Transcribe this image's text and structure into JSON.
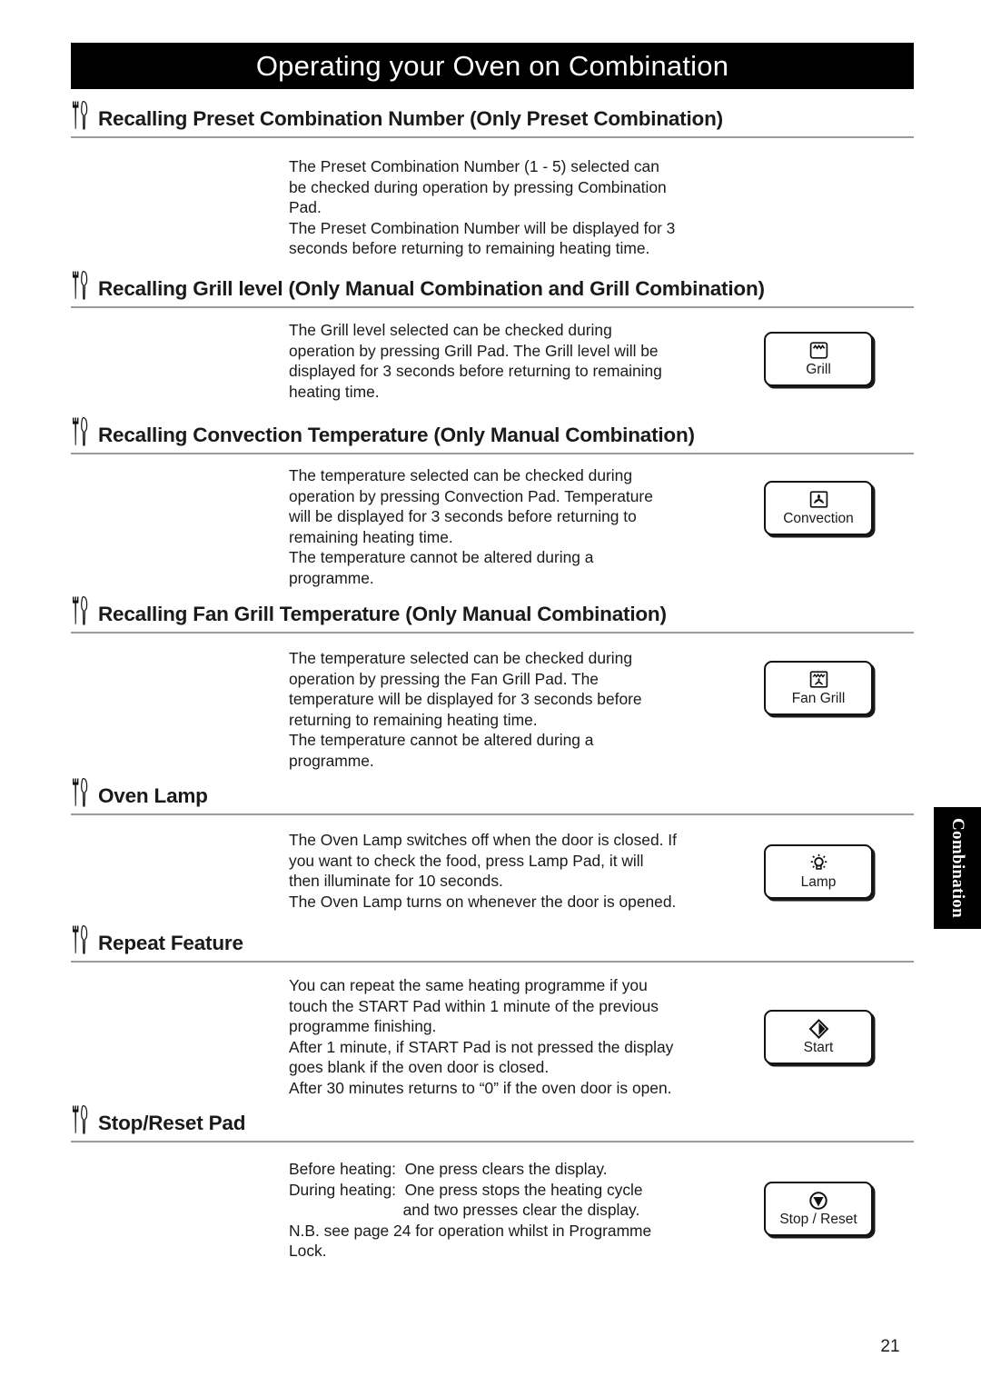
{
  "page": {
    "banner_title": "Operating your Oven on Combination",
    "side_tab_label": "Combination",
    "page_number": "21"
  },
  "sections": [
    {
      "heading": "Recalling Preset Combination Number (Only Preset Combination)",
      "lines": [
        "The Preset Combination Number (1 - 5) selected can",
        "be checked during operation by pressing Combination",
        "Pad.",
        "The Preset Combination Number will be displayed for 3",
        "seconds before returning to remaining heating time."
      ],
      "pad": null
    },
    {
      "heading": "Recalling Grill level (Only Manual Combination and Grill Combination)",
      "lines": [
        "The Grill level selected can be checked during",
        "operation by pressing Grill Pad. The Grill level will be",
        "displayed for 3 seconds before returning to remaining",
        "heating time."
      ],
      "pad": {
        "label": "Grill",
        "icon": "grill-element-icon"
      }
    },
    {
      "heading": "Recalling Convection Temperature (Only Manual Combination)",
      "lines": [
        "The temperature selected can be checked during",
        "operation by pressing Convection Pad. Temperature",
        "will be displayed for 3 seconds before returning to",
        "remaining heating time.",
        "The temperature cannot be altered during a",
        "programme."
      ],
      "pad": {
        "label": "Convection",
        "icon": "fan-icon"
      }
    },
    {
      "heading": "Recalling Fan Grill Temperature (Only Manual Combination)",
      "lines": [
        "The temperature selected can be checked during",
        "operation by pressing the Fan Grill Pad. The",
        "temperature will be displayed for 3 seconds before",
        "returning to remaining heating time.",
        "The temperature cannot be altered during a",
        "programme."
      ],
      "pad": {
        "label": "Fan Grill",
        "icon": "fan-grill-icon"
      }
    },
    {
      "heading": "Oven Lamp",
      "lines": [
        "The Oven Lamp switches off when the door is closed. If",
        "you want to check the food, press Lamp Pad, it will",
        "then illuminate for 10 seconds.",
        "The Oven Lamp turns on whenever the door is opened."
      ],
      "pad": {
        "label": "Lamp",
        "icon": "light-bulb-icon"
      }
    },
    {
      "heading": "Repeat Feature",
      "lines": [
        "You can repeat the same heating programme if you",
        "touch the START Pad within 1 minute of the previous",
        "programme finishing.",
        "After 1 minute, if START Pad is not pressed the display",
        "goes blank if the oven door is closed.",
        "After 30 minutes returns to “0” if the oven door is open."
      ],
      "pad": {
        "label": "Start",
        "icon": "diamond-start-icon"
      }
    },
    {
      "heading": "Stop/Reset Pad",
      "lines": [
        "Before heating:  One press clears the display.",
        "During heating:  One press stops the heating cycle",
        "                          and two presses clear the display.",
        "N.B. see page 24 for operation whilst in Programme",
        "Lock."
      ],
      "pad": {
        "label": "Stop / Reset",
        "icon": "stop-circle-icon"
      }
    }
  ]
}
